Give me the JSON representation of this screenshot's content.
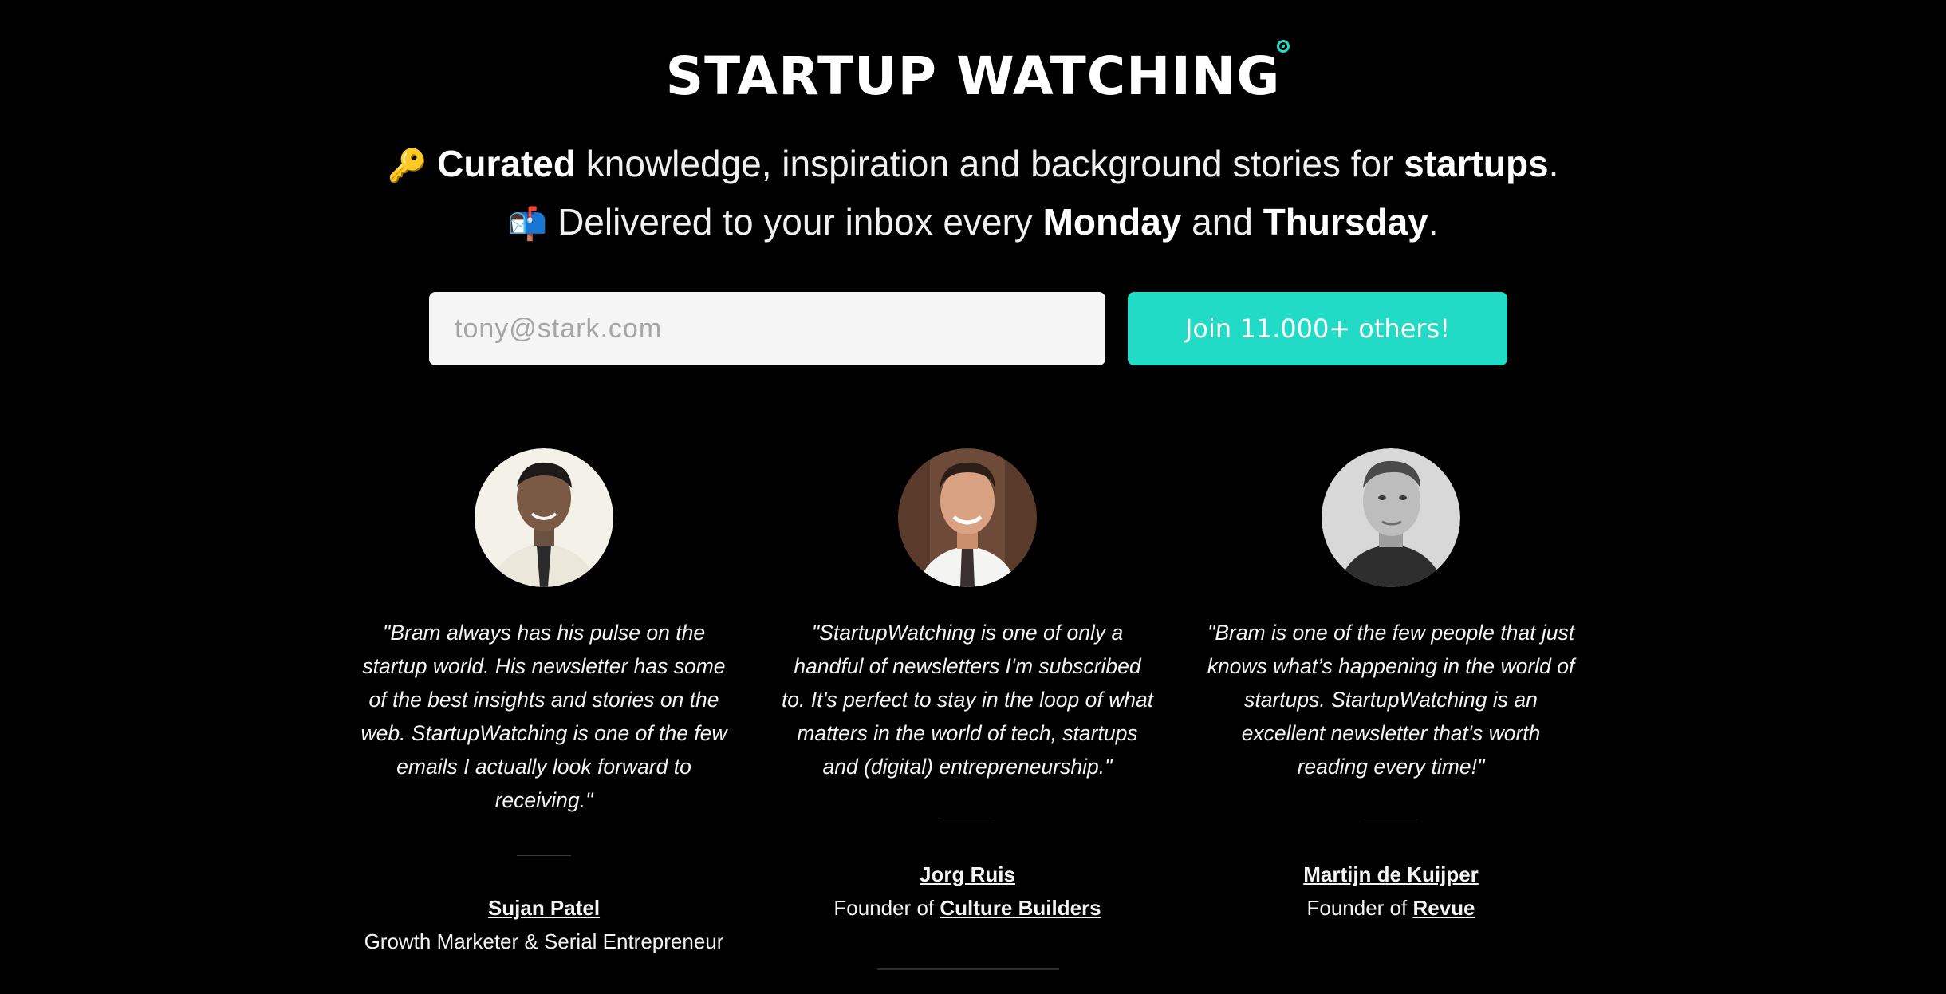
{
  "logo": {
    "text": "STARTUP WATCHING"
  },
  "tagline": {
    "line1": {
      "emoji": "🔑",
      "bold1": "Curated",
      "text1": " knowledge, inspiration and background stories for ",
      "bold2": "startups",
      "text2": "."
    },
    "line2": {
      "emoji": "📬",
      "text1": " Delivered to your inbox every ",
      "bold1": "Monday",
      "text2": " and ",
      "bold2": "Thursday",
      "text3": "."
    }
  },
  "signup": {
    "email_placeholder": "tony@stark.com",
    "email_value": "",
    "button_label": "Join 11.000+ others!"
  },
  "testimonials": [
    {
      "quote": "\"Bram always has his pulse on the startup world. His newsletter has some of the best insights and stories on the web. StartupWatching is one of the few emails I actually look forward to receiving.\"",
      "name": "Sujan Patel",
      "role_text": "Growth Marketer & Serial Entrepreneur",
      "role_link": ""
    },
    {
      "quote": "\"StartupWatching is one of only a handful of newsletters I'm subscribed to. It's perfect to stay in the loop of what matters in the world of tech, startups and (digital) entrepreneurship.\"",
      "name": "Jorg Ruis",
      "role_text": "Founder of ",
      "role_link": "Culture Builders"
    },
    {
      "quote": "\"Bram is one of the few people that just knows what’s happening in the world of startups. StartupWatching is an excellent newsletter that's worth reading every time!\"",
      "name": "Martijn de Kuijper",
      "role_text": "Founder of ",
      "role_link": "Revue"
    }
  ],
  "colors": {
    "background": "#000000",
    "accent": "#22dbc6",
    "input_bg": "#f5f5f5"
  }
}
